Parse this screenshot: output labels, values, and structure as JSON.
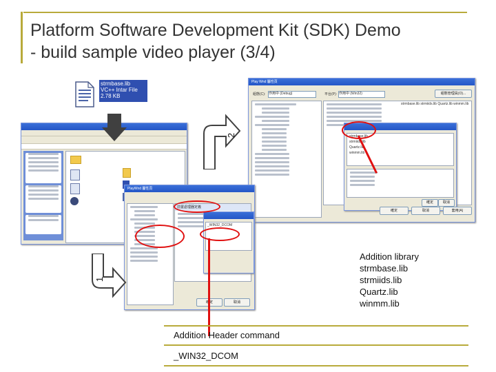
{
  "slide": {
    "title_line1": "Platform Software Development Kit (SDK) Demo",
    "title_line2": "- build sample video player (3/4)"
  },
  "file_icon": {
    "name": "strmbase.lib",
    "type": "VC++ Intar File",
    "size": "2.78 KB"
  },
  "steps": {
    "one": "1",
    "two": "2"
  },
  "annotations": {
    "library_heading": "Addition library",
    "libraries": [
      "strmbase.lib",
      "strmiids.lib",
      "Quartz.lib",
      "winmm.lib"
    ],
    "header_command": "Addition Header command",
    "define": "_WIN32_DCOM"
  },
  "dialog_back": {
    "title": "Play Wnd 屬性頁",
    "config_label": "組態(C):",
    "config_value": "作用中 (Debug)",
    "platform_label": "平台(P):",
    "platform_value": "作用中 (Win32)",
    "manager_button": "組態管理員(O)...",
    "deps_value": "strmbase.lib strmiids.lib Quartz.lib winmm.lib",
    "inner_libs": [
      "strmbase.lib",
      "strmiids.lib",
      "Quartz.lib",
      "winmm.lib"
    ],
    "ok": "確定",
    "cancel": "取消",
    "apply": "套用(A)"
  },
  "dialog_front": {
    "title": "PlayWnd 屬性頁",
    "preproc_label": "前置處理器定義",
    "preproc_value": "_WIN32_DCOM",
    "ok": "確定",
    "cancel": "取消"
  }
}
